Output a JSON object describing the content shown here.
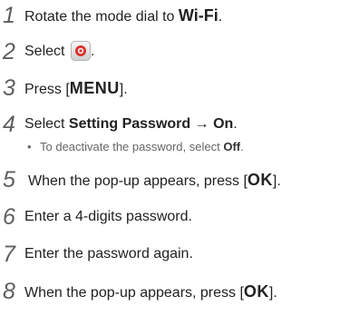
{
  "steps": [
    {
      "num": "1",
      "pre": "Rotate the mode dial to ",
      "bold": "Wi-Fi",
      "post": "."
    },
    {
      "num": "2",
      "pre": "Select ",
      "icon": "mobile-link-app-icon",
      "post": "."
    },
    {
      "num": "3",
      "pre": "Press [",
      "key": "MENU",
      "post": "]."
    },
    {
      "num": "4",
      "pre": "Select ",
      "bold": "Setting Password",
      "mid": " → ",
      "bold2": "On",
      "post": "."
    },
    {
      "num": "5",
      "pre": "When the pop-up appears, press [",
      "key": "OK",
      "post": "]."
    },
    {
      "num": "6",
      "pre": "Enter a 4-digits password."
    },
    {
      "num": "7",
      "pre": "Enter the password again."
    },
    {
      "num": "8",
      "pre": "When the pop-up appears, press [",
      "key": "OK",
      "post": "]."
    }
  ],
  "substep": {
    "bullet": "•",
    "pre": "To deactivate the password, select ",
    "bold": "Off",
    "post": "."
  },
  "colors": {
    "step_number": "#5f5f5f",
    "text": "#222222",
    "subtext": "#666666",
    "icon_accent": "#d9302a"
  }
}
